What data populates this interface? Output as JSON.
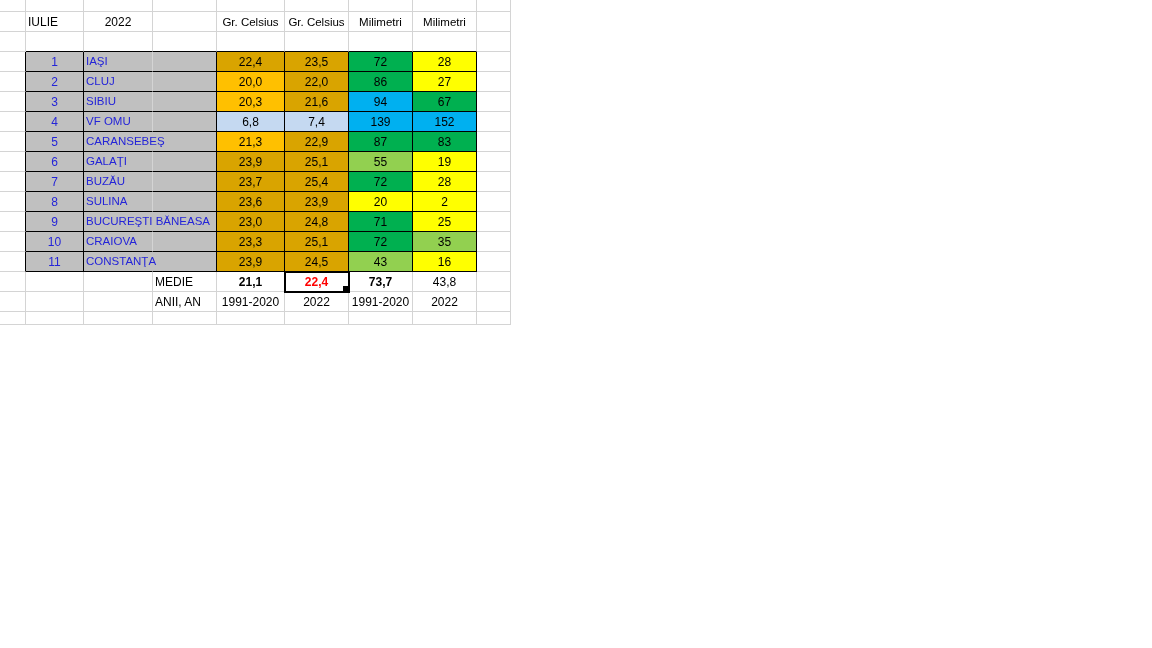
{
  "header": {
    "month": "IULIE",
    "year": "2022",
    "units": [
      "Gr. Celsius",
      "Gr. Celsius",
      "Milimetri",
      "Milimetri"
    ]
  },
  "rows": [
    {
      "num": "1",
      "station": "IAŞI",
      "values": [
        {
          "text": "22,4",
          "color": "#d9a400"
        },
        {
          "text": "23,5",
          "color": "#d9a400"
        },
        {
          "text": "72",
          "color": "#00b050"
        },
        {
          "text": "28",
          "color": "#ffff00"
        }
      ]
    },
    {
      "num": "2",
      "station": "CLUJ",
      "values": [
        {
          "text": "20,0",
          "color": "#ffc000"
        },
        {
          "text": "22,0",
          "color": "#d9a400"
        },
        {
          "text": "86",
          "color": "#00b050"
        },
        {
          "text": "27",
          "color": "#ffff00"
        }
      ]
    },
    {
      "num": "3",
      "station": "SIBIU",
      "values": [
        {
          "text": "20,3",
          "color": "#ffc000"
        },
        {
          "text": "21,6",
          "color": "#d9a400"
        },
        {
          "text": "94",
          "color": "#00b0f0"
        },
        {
          "text": "67",
          "color": "#00b050"
        }
      ]
    },
    {
      "num": "4",
      "station": "VF OMU",
      "values": [
        {
          "text": "6,8",
          "color": "#c5d9f1"
        },
        {
          "text": "7,4",
          "color": "#c5d9f1"
        },
        {
          "text": "139",
          "color": "#00b0f0"
        },
        {
          "text": "152",
          "color": "#00b0f0"
        }
      ]
    },
    {
      "num": "5",
      "station": "CARANSEBEŞ",
      "values": [
        {
          "text": "21,3",
          "color": "#ffc000"
        },
        {
          "text": "22,9",
          "color": "#d9a400"
        },
        {
          "text": "87",
          "color": "#00b050"
        },
        {
          "text": "83",
          "color": "#00b050"
        }
      ]
    },
    {
      "num": "6",
      "station": "GALAŢI",
      "values": [
        {
          "text": "23,9",
          "color": "#d9a400"
        },
        {
          "text": "25,1",
          "color": "#d9a400"
        },
        {
          "text": "55",
          "color": "#92d050"
        },
        {
          "text": "19",
          "color": "#ffff00"
        }
      ]
    },
    {
      "num": "7",
      "station": "BUZĂU",
      "values": [
        {
          "text": "23,7",
          "color": "#d9a400"
        },
        {
          "text": "25,4",
          "color": "#d9a400"
        },
        {
          "text": "72",
          "color": "#00b050"
        },
        {
          "text": "28",
          "color": "#ffff00"
        }
      ]
    },
    {
      "num": "8",
      "station": "SULINA",
      "values": [
        {
          "text": "23,6",
          "color": "#d9a400"
        },
        {
          "text": "23,9",
          "color": "#d9a400"
        },
        {
          "text": "20",
          "color": "#ffff00"
        },
        {
          "text": "2",
          "color": "#ffff00"
        }
      ]
    },
    {
      "num": "9",
      "station": "BUCUREŞTI BĂNEASA",
      "values": [
        {
          "text": "23,0",
          "color": "#d9a400"
        },
        {
          "text": "24,8",
          "color": "#d9a400"
        },
        {
          "text": "71",
          "color": "#00b050"
        },
        {
          "text": "25",
          "color": "#ffff00"
        }
      ]
    },
    {
      "num": "10",
      "station": "CRAIOVA",
      "values": [
        {
          "text": "23,3",
          "color": "#d9a400"
        },
        {
          "text": "25,1",
          "color": "#d9a400"
        },
        {
          "text": "72",
          "color": "#00b050"
        },
        {
          "text": "35",
          "color": "#92d050"
        }
      ]
    },
    {
      "num": "11",
      "station": "CONSTANŢA",
      "values": [
        {
          "text": "23,9",
          "color": "#d9a400"
        },
        {
          "text": "24,5",
          "color": "#d9a400"
        },
        {
          "text": "43",
          "color": "#92d050"
        },
        {
          "text": "16",
          "color": "#ffff00"
        }
      ]
    }
  ],
  "average": {
    "label": "MEDIE",
    "values": [
      {
        "text": "21,1",
        "bold": true,
        "color": "#000000",
        "selected": false
      },
      {
        "text": "22,4",
        "bold": true,
        "color": "#ff0000",
        "selected": true
      },
      {
        "text": "73,7",
        "bold": true,
        "color": "#000000",
        "selected": false
      },
      {
        "text": "43,8",
        "bold": false,
        "color": "#000000",
        "selected": false
      }
    ]
  },
  "periods": {
    "label": "ANII, AN",
    "values": [
      "1991-2020",
      "2022",
      "1991-2020",
      "2022"
    ]
  }
}
